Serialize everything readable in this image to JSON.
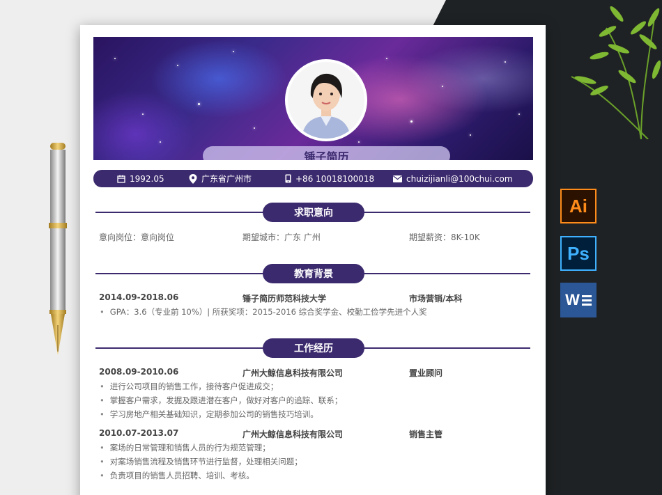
{
  "header": {
    "name": "锤子简历",
    "birth": "1992.05",
    "location": "广东省广州市",
    "phone": "+86 10018100018",
    "email": "chuizijianli@100chui.com"
  },
  "sections": {
    "job_intent": {
      "title": "求职意向",
      "position": "意向岗位：意向岗位",
      "city": "期望城市：广东 广州",
      "salary": "期望薪资：8K-10K"
    },
    "education": {
      "title": "教育背景",
      "period": "2014.09-2018.06",
      "school": "锤子简历师范科技大学",
      "major": "市场营销/本科",
      "details": [
        "GPA：3.6（专业前 10%）| 所获奖项：2015-2016 综合奖学金、校勤工俭学先进个人奖"
      ]
    },
    "work": {
      "title": "工作经历",
      "jobs": [
        {
          "period": "2008.09-2010.06",
          "company": "广州大鲸信息科技有限公司",
          "role": "置业顾问",
          "duties": [
            "进行公司项目的销售工作，接待客户促进成交；",
            "掌握客户需求，发掘及跟进潜在客户，做好对客户的追踪、联系；",
            "学习房地产相关基础知识，定期参加公司的销售技巧培训。"
          ]
        },
        {
          "period": "2010.07-2013.07",
          "company": "广州大鲸信息科技有限公司",
          "role": "销售主管",
          "duties": [
            "案场的日常管理和销售人员的行为规范管理；",
            "对案场销售流程及销售环节进行监督，处理相关问题；",
            "负责项目的销售人员招聘、培训、考核。"
          ]
        }
      ]
    }
  },
  "apps": {
    "ai": "Ai",
    "ps": "Ps",
    "word": "W"
  },
  "colors": {
    "accent": "#3c2a6e",
    "ai": "#ff8c1a",
    "ps": "#3fb1ff",
    "word": "#2b5797"
  }
}
